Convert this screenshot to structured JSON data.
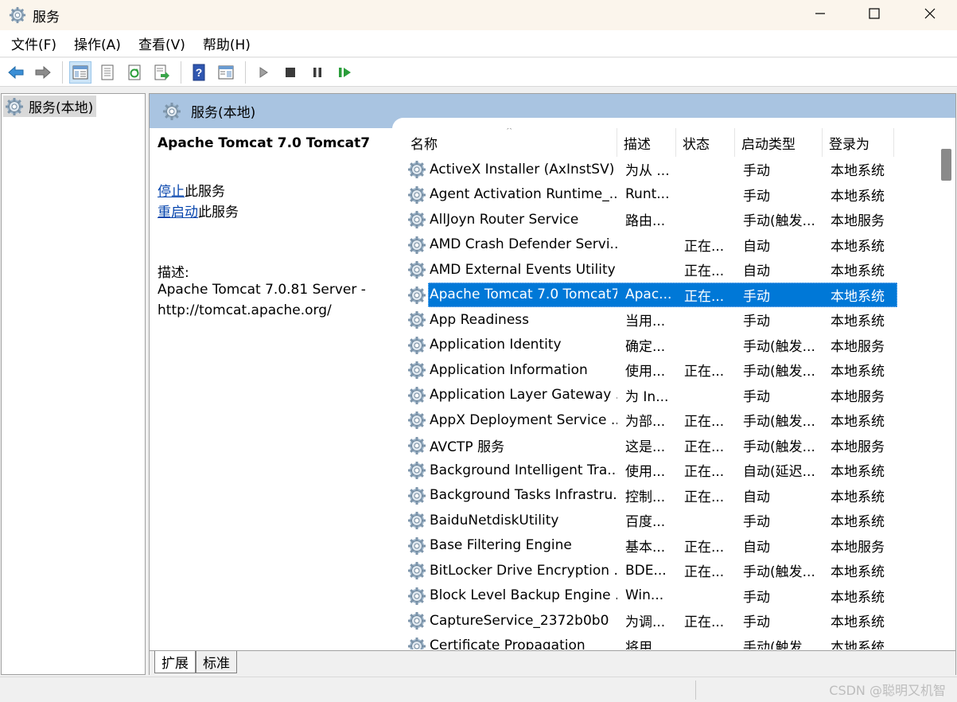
{
  "window": {
    "title": "服务"
  },
  "menu": [
    "文件(F)",
    "操作(A)",
    "查看(V)",
    "帮助(H)"
  ],
  "tree": {
    "item": "服务(本地)"
  },
  "main": {
    "header": "服务(本地)",
    "detail": {
      "title": "Apache Tomcat 7.0 Tomcat7",
      "stop_link": "停止",
      "stop_suffix": "此服务",
      "restart_link": "重启动",
      "restart_suffix": "此服务",
      "desc_label": "描述:",
      "desc_line1": "Apache Tomcat 7.0.81 Server -",
      "desc_line2": "http://tomcat.apache.org/"
    },
    "columns": [
      "名称",
      "描述",
      "状态",
      "启动类型",
      "登录为"
    ],
    "sort_indicator": "^",
    "rows": [
      {
        "name": "ActiveX Installer (AxInstSV)",
        "desc": "为从 ...",
        "status": "",
        "startup": "手动",
        "logon": "本地系统"
      },
      {
        "name": "Agent Activation Runtime_...",
        "desc": "Runt...",
        "status": "",
        "startup": "手动",
        "logon": "本地系统"
      },
      {
        "name": "AllJoyn Router Service",
        "desc": "路由...",
        "status": "",
        "startup": "手动(触发...",
        "logon": "本地服务"
      },
      {
        "name": "AMD Crash Defender Servi...",
        "desc": "",
        "status": "正在...",
        "startup": "自动",
        "logon": "本地系统"
      },
      {
        "name": "AMD External Events Utility",
        "desc": "",
        "status": "正在...",
        "startup": "自动",
        "logon": "本地系统"
      },
      {
        "name": "Apache Tomcat 7.0 Tomcat7",
        "desc": "Apac...",
        "status": "正在...",
        "startup": "手动",
        "logon": "本地系统",
        "selected": true
      },
      {
        "name": "App Readiness",
        "desc": "当用...",
        "status": "",
        "startup": "手动",
        "logon": "本地系统"
      },
      {
        "name": "Application Identity",
        "desc": "确定...",
        "status": "",
        "startup": "手动(触发...",
        "logon": "本地服务"
      },
      {
        "name": "Application Information",
        "desc": "使用...",
        "status": "正在...",
        "startup": "手动(触发...",
        "logon": "本地系统"
      },
      {
        "name": "Application Layer Gateway ...",
        "desc": "为 In...",
        "status": "",
        "startup": "手动",
        "logon": "本地服务"
      },
      {
        "name": "AppX Deployment Service ...",
        "desc": "为部...",
        "status": "正在...",
        "startup": "手动(触发...",
        "logon": "本地系统"
      },
      {
        "name": "AVCTP 服务",
        "desc": "这是...",
        "status": "正在...",
        "startup": "手动(触发...",
        "logon": "本地服务"
      },
      {
        "name": "Background Intelligent Tra...",
        "desc": "使用...",
        "status": "正在...",
        "startup": "自动(延迟...",
        "logon": "本地系统"
      },
      {
        "name": "Background Tasks Infrastru...",
        "desc": "控制...",
        "status": "正在...",
        "startup": "自动",
        "logon": "本地系统"
      },
      {
        "name": "BaiduNetdiskUtility",
        "desc": "百度...",
        "status": "",
        "startup": "手动",
        "logon": "本地系统"
      },
      {
        "name": "Base Filtering Engine",
        "desc": "基本...",
        "status": "正在...",
        "startup": "自动",
        "logon": "本地服务"
      },
      {
        "name": "BitLocker Drive Encryption ...",
        "desc": "BDE...",
        "status": "正在...",
        "startup": "手动(触发...",
        "logon": "本地系统"
      },
      {
        "name": "Block Level Backup Engine ...",
        "desc": "Win...",
        "status": "",
        "startup": "手动",
        "logon": "本地系统"
      },
      {
        "name": "CaptureService_2372b0b0",
        "desc": "为调...",
        "status": "正在...",
        "startup": "手动",
        "logon": "本地系统"
      },
      {
        "name": "Certificate Propagation",
        "desc": "将用...",
        "status": "",
        "startup": "手动(触发...",
        "logon": "本地系统"
      }
    ]
  },
  "tabs": [
    "扩展",
    "标准"
  ],
  "watermark": "CSDN @聪明又机智",
  "colors": {
    "selection": "#0078d7",
    "header_band": "#a9c4e1",
    "link": "#0645ad"
  },
  "icons": [
    "gear-icon",
    "back-arrow-icon",
    "forward-arrow-icon",
    "show-tree-icon",
    "properties-icon",
    "refresh-icon",
    "export-icon",
    "help-icon",
    "console-icon",
    "play-icon",
    "stop-icon",
    "pause-icon",
    "resume-icon"
  ]
}
